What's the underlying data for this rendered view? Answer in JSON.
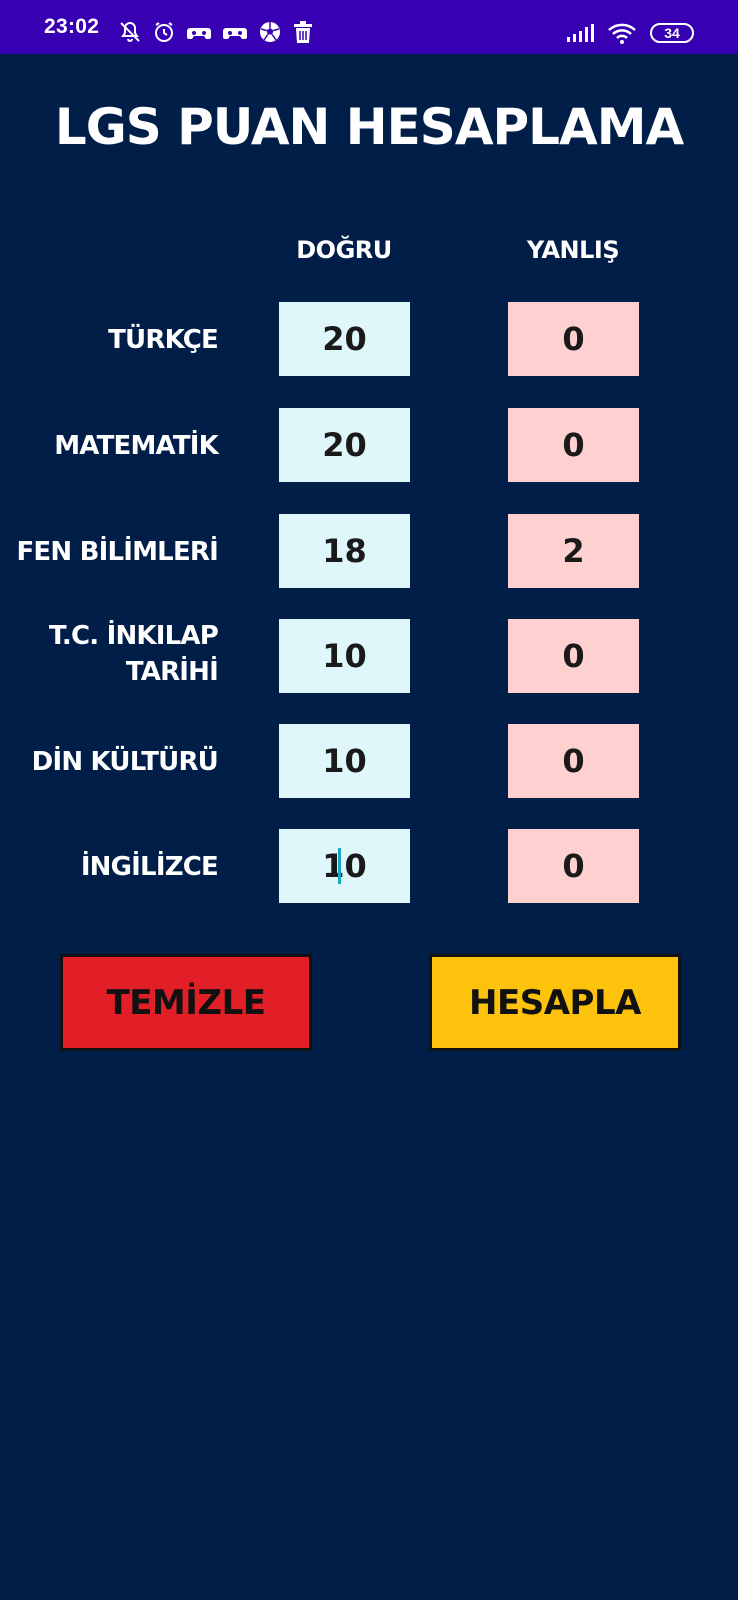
{
  "status_bar": {
    "time": "23:02",
    "battery": "34",
    "left_icons": [
      "bell-off-icon",
      "alarm-icon",
      "cloud-game-icon",
      "cloud-game-icon",
      "soccer-ball-icon",
      "trash-icon"
    ],
    "right_icons": [
      "signal-icon",
      "wifi-icon",
      "battery-icon"
    ]
  },
  "app": {
    "title": "LGS PUAN HESAPLAMA"
  },
  "columns": {
    "correct": "DOĞRU",
    "wrong": "YANLIŞ"
  },
  "subjects": [
    {
      "label": "TÜRKÇE",
      "correct": "20",
      "wrong": "0"
    },
    {
      "label": "MATEMATİK",
      "correct": "20",
      "wrong": "0"
    },
    {
      "label": "FEN BİLİMLERİ",
      "correct": "18",
      "wrong": "2"
    },
    {
      "label_line1": "T.C. İNKILAP",
      "label_line2": "TARİHİ",
      "correct": "10",
      "wrong": "0"
    },
    {
      "label": "DİN KÜLTÜRÜ",
      "correct": "10",
      "wrong": "0"
    },
    {
      "label": "İNGİLİZCE",
      "correct": "10",
      "wrong": "0"
    }
  ],
  "buttons": {
    "clear": "TEMİZLE",
    "calculate": "HESAPLA"
  },
  "colors": {
    "background": "#001e48",
    "status_bar": "#3700b3",
    "correct_box": "#dff7fb",
    "wrong_box": "#ffd0d0",
    "clear_button": "#e21f26",
    "calculate_button": "#fdc30c"
  }
}
